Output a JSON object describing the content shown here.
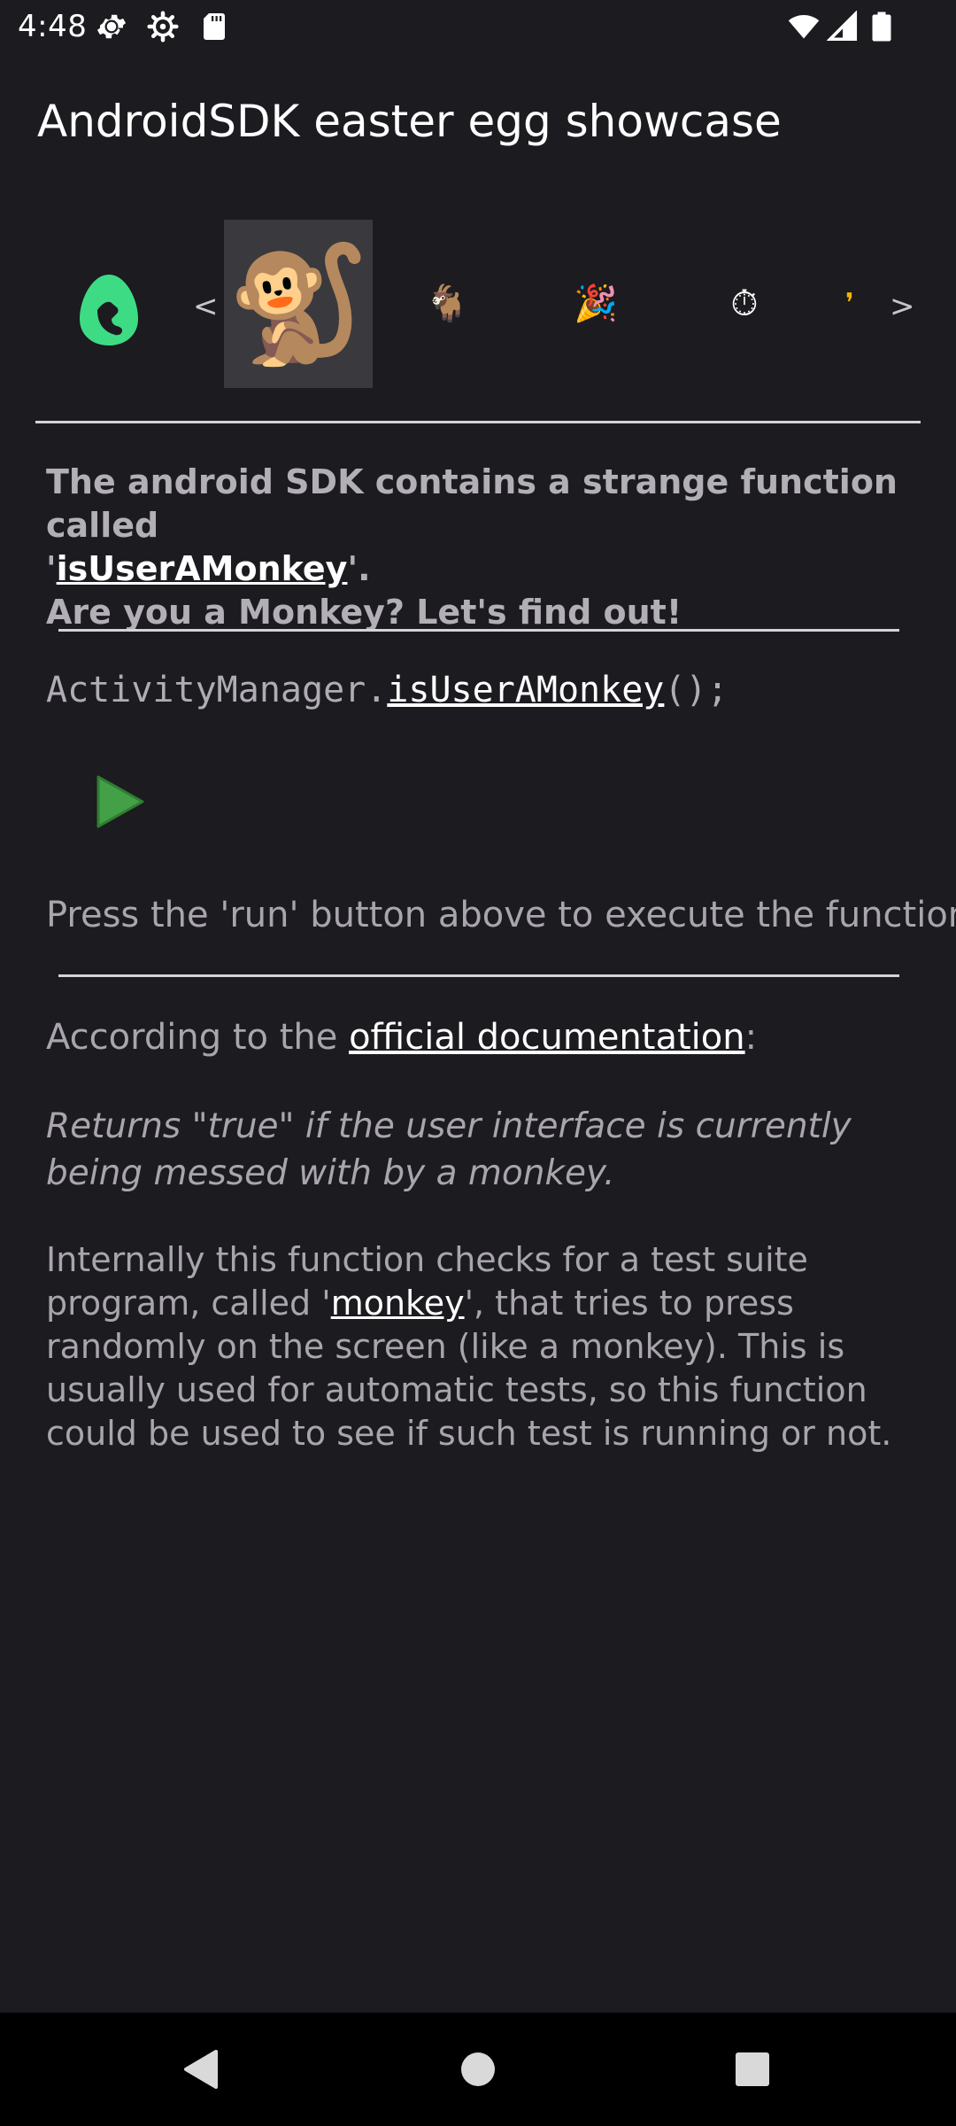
{
  "status_bar": {
    "time": "4:48",
    "icons_left": [
      "settings-gear-icon",
      "settings-gear-outline-icon",
      "sd-card-icon"
    ],
    "icons_right": [
      "wifi-icon",
      "cell-signal-icon",
      "battery-icon"
    ]
  },
  "app": {
    "title": "AndroidSDK easter egg showcase"
  },
  "egg_strip": {
    "prev_arrow": "<",
    "next_arrow": ">",
    "items": [
      {
        "name": "monkey",
        "glyph": "🐒",
        "selected": true
      },
      {
        "name": "goat",
        "glyph": "🐐",
        "selected": false
      },
      {
        "name": "party-popper",
        "glyph": "🎉",
        "selected": false
      },
      {
        "name": "stopwatch",
        "glyph": "⏱",
        "selected": false
      },
      {
        "name": "partial",
        "glyph": "❜",
        "selected": false
      }
    ]
  },
  "intro": {
    "line1": "The android SDK contains a strange function called",
    "quote_open": "'",
    "function_link": "isUserAMonkey",
    "quote_close": "'.",
    "line3": "Are you a Monkey? Let's find out!"
  },
  "code": {
    "prefix": "ActivityManager.",
    "function": "isUserAMonkey",
    "suffix": "();"
  },
  "run_hint": "Press the 'run' button above to execute the function",
  "docs": {
    "intro_prefix": "According to the ",
    "link": "official documentation",
    "intro_suffix": ":",
    "quote": "Returns \"true\" if the user interface is currently being messed with by a monkey.",
    "explain_part1": "Internally this function checks for a test suite program, called '",
    "explain_link": "monkey",
    "explain_part2": "', that tries to press randomly on the screen (like a monkey). This is usually used for automatic tests, so this function could be used to see if such test is running or not."
  },
  "colors": {
    "background": "#1c1b20",
    "accent_green": "#3ddc84",
    "run_green": "#43a047",
    "link": "#ffffff"
  }
}
